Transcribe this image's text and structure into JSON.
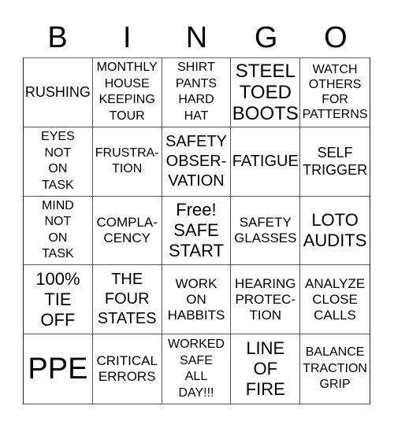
{
  "title_letters": [
    "B",
    "I",
    "N",
    "G",
    "O"
  ],
  "card": {
    "rows": [
      [
        "RUSHING",
        "MONTHLY\nHOUSE\nKEEPING\nTOUR",
        "SHIRT\nPANTS\nHARD\nHAT",
        "STEEL\nTOED\nBOOTS",
        "WATCH\nOTHERS\nFOR\nPATTERNS"
      ],
      [
        "EYES\nNOT\nON\nTASK",
        "FRUSTRA-\nTION",
        "SAFETY\nOBSER-\nVATION",
        "FATIGUE",
        "SELF\nTRIGGER"
      ],
      [
        "MIND\nNOT\nON\nTASK",
        "COMPLA-\nCENCY",
        "Free!\nSAFE\nSTART",
        "SAFETY\nGLASSES",
        "LOTO\nAUDITS"
      ],
      [
        "100%\nTIE\nOFF",
        "THE\nFOUR\nSTATES",
        "WORK\nON\nHABBITS",
        "HEARING\nPROTEC-\nTION",
        "ANALYZE\nCLOSE\nCALLS"
      ],
      [
        "PPE",
        "CRITICAL\nERRORS",
        "WORKED\nSAFE\nALL\nDAY!!!",
        "LINE\nOF\nFIRE",
        "BALANCE\nTRACTION\nGRIP"
      ]
    ],
    "free_space": {
      "row": 2,
      "col": 2
    }
  }
}
